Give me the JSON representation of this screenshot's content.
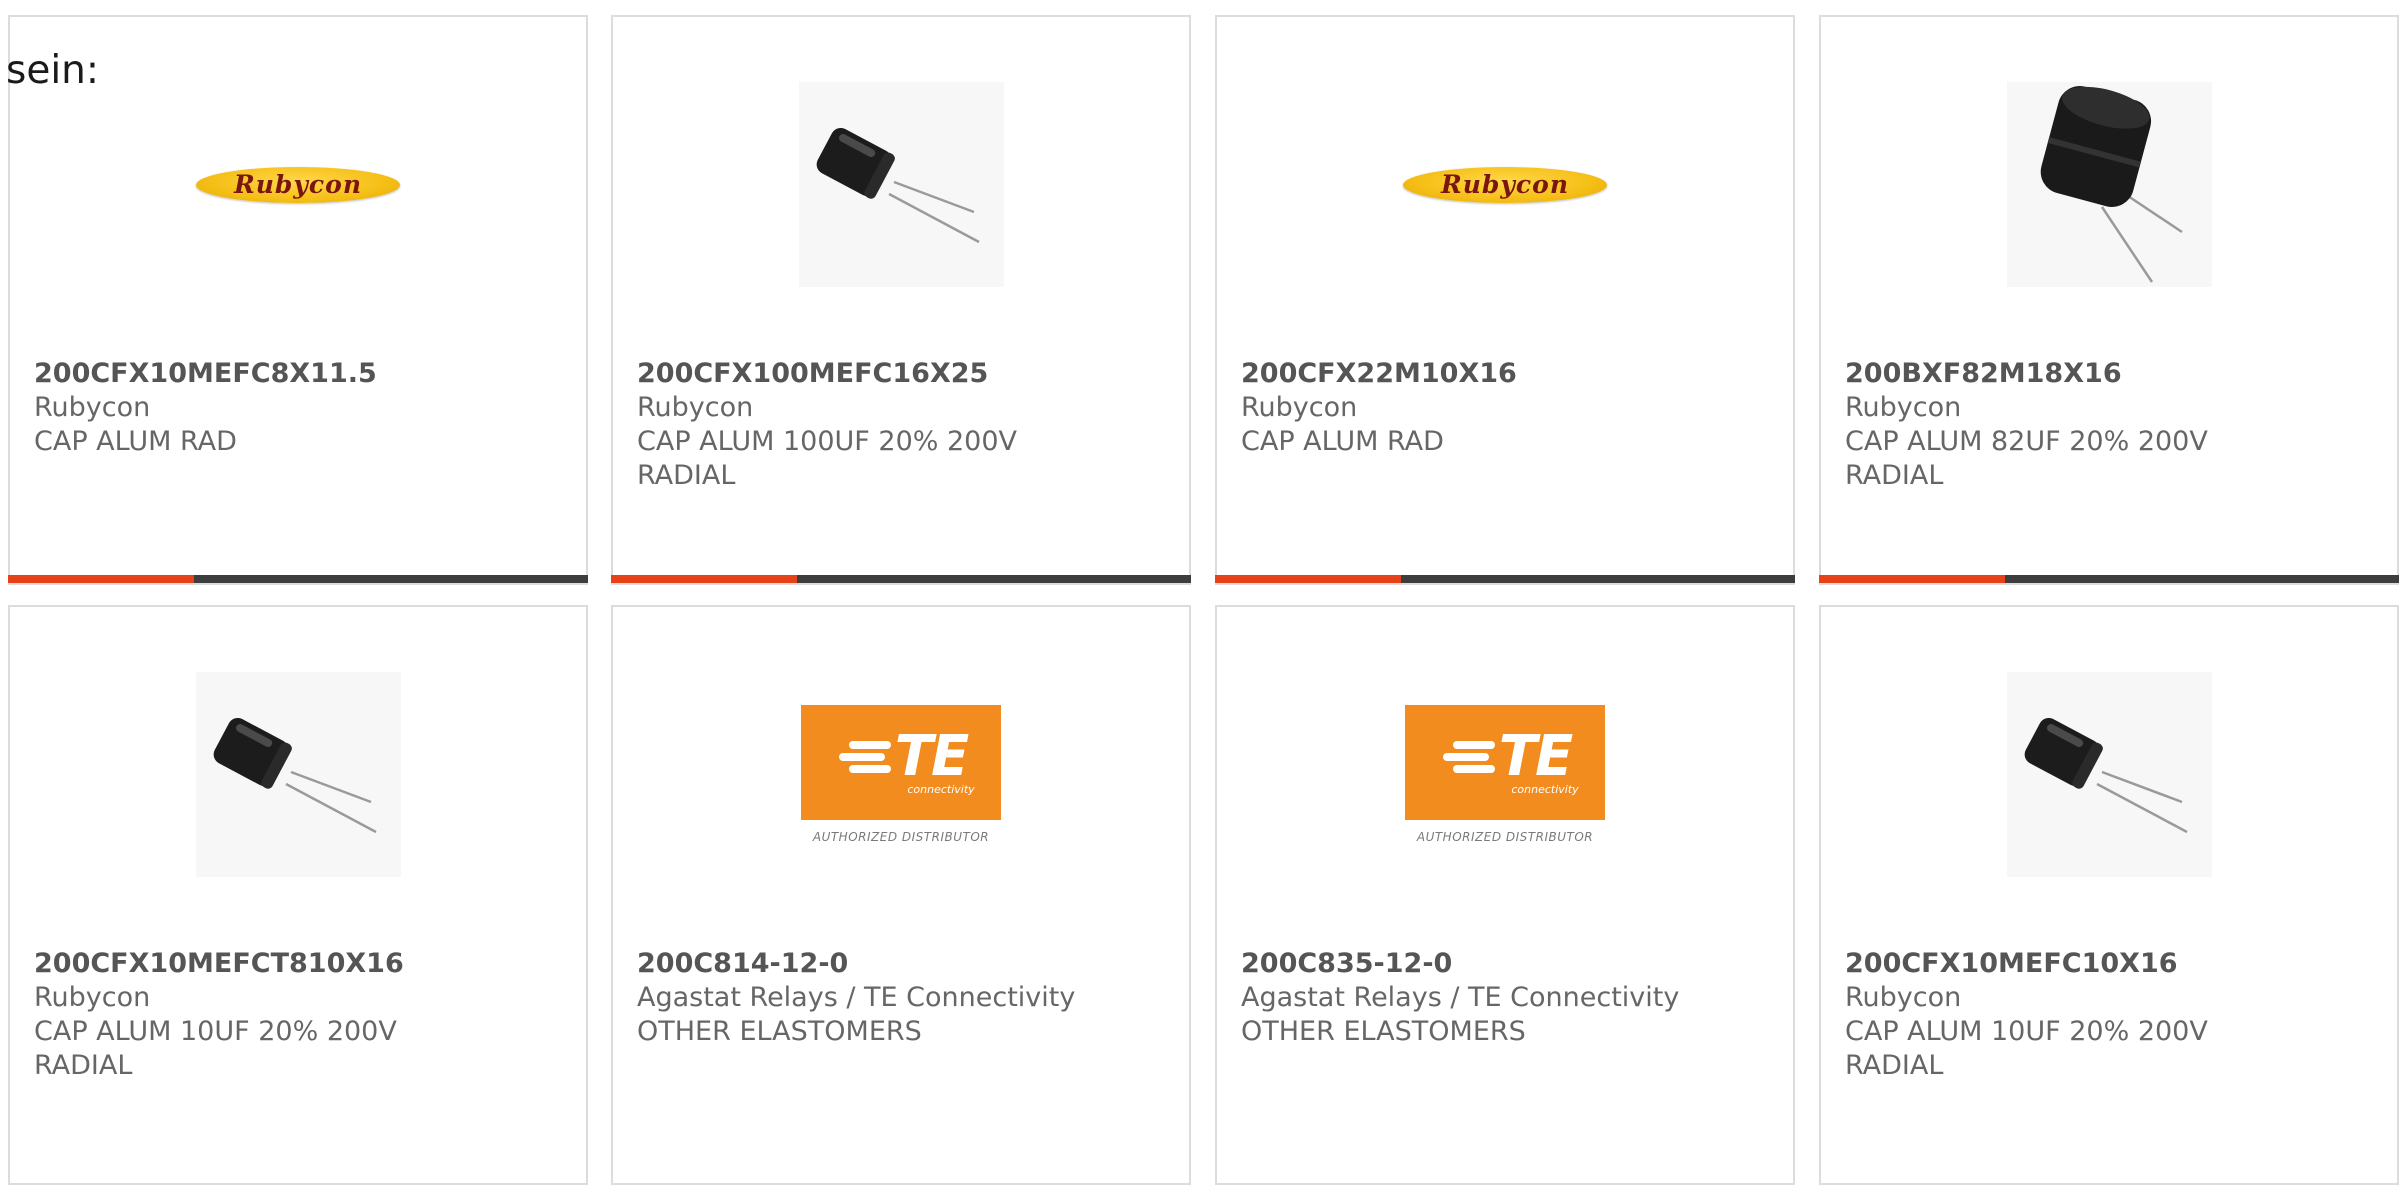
{
  "page": {
    "label": "sein:"
  },
  "products": [
    {
      "part": "200CFX10MEFC8X11.5",
      "manufacturer": "Rubycon",
      "description": "CAP ALUM RAD",
      "image": "rubycon-logo",
      "logo_text": "Rubycon"
    },
    {
      "part": "200CFX100MEFC16X25",
      "manufacturer": "Rubycon",
      "description": "CAP ALUM 100UF 20% 200V RADIAL",
      "image": "capacitor-photo"
    },
    {
      "part": "200CFX22M10X16",
      "manufacturer": "Rubycon",
      "description": "CAP ALUM RAD",
      "image": "rubycon-logo",
      "logo_text": "Rubycon"
    },
    {
      "part": "200BXF82M18X16",
      "manufacturer": "Rubycon",
      "description": "CAP ALUM 82UF 20% 200V RADIAL",
      "image": "capacitor-photo-large"
    },
    {
      "part": "200CFX10MEFCT810X16",
      "manufacturer": "Rubycon",
      "description": "CAP ALUM 10UF 20% 200V RADIAL",
      "image": "capacitor-photo"
    },
    {
      "part": "200C814-12-0",
      "manufacturer": "Agastat Relays / TE Connectivity",
      "description": "OTHER ELASTOMERS",
      "image": "te-connectivity-logo",
      "logo_text": "TE",
      "logo_sub": "connectivity",
      "logo_caption": "AUTHORIZED DISTRIBUTOR"
    },
    {
      "part": "200C835-12-0",
      "manufacturer": "Agastat Relays / TE Connectivity",
      "description": "OTHER ELASTOMERS",
      "image": "te-connectivity-logo",
      "logo_text": "TE",
      "logo_sub": "connectivity",
      "logo_caption": "AUTHORIZED DISTRIBUTOR"
    },
    {
      "part": "200CFX10MEFC10X16",
      "manufacturer": "Rubycon",
      "description": "CAP ALUM 10UF 20% 200V RADIAL",
      "image": "capacitor-photo"
    }
  ],
  "carousel_progress": {
    "fill_fraction": 0.32,
    "fill_color": "#e5421a",
    "track_color": "#3d3d3d"
  },
  "colors": {
    "text_part": "#555555",
    "text_meta": "#666666",
    "card_border": "#dcdcdc",
    "rubycon_yellow": "#f5bf16",
    "te_orange": "#f28c1f"
  }
}
